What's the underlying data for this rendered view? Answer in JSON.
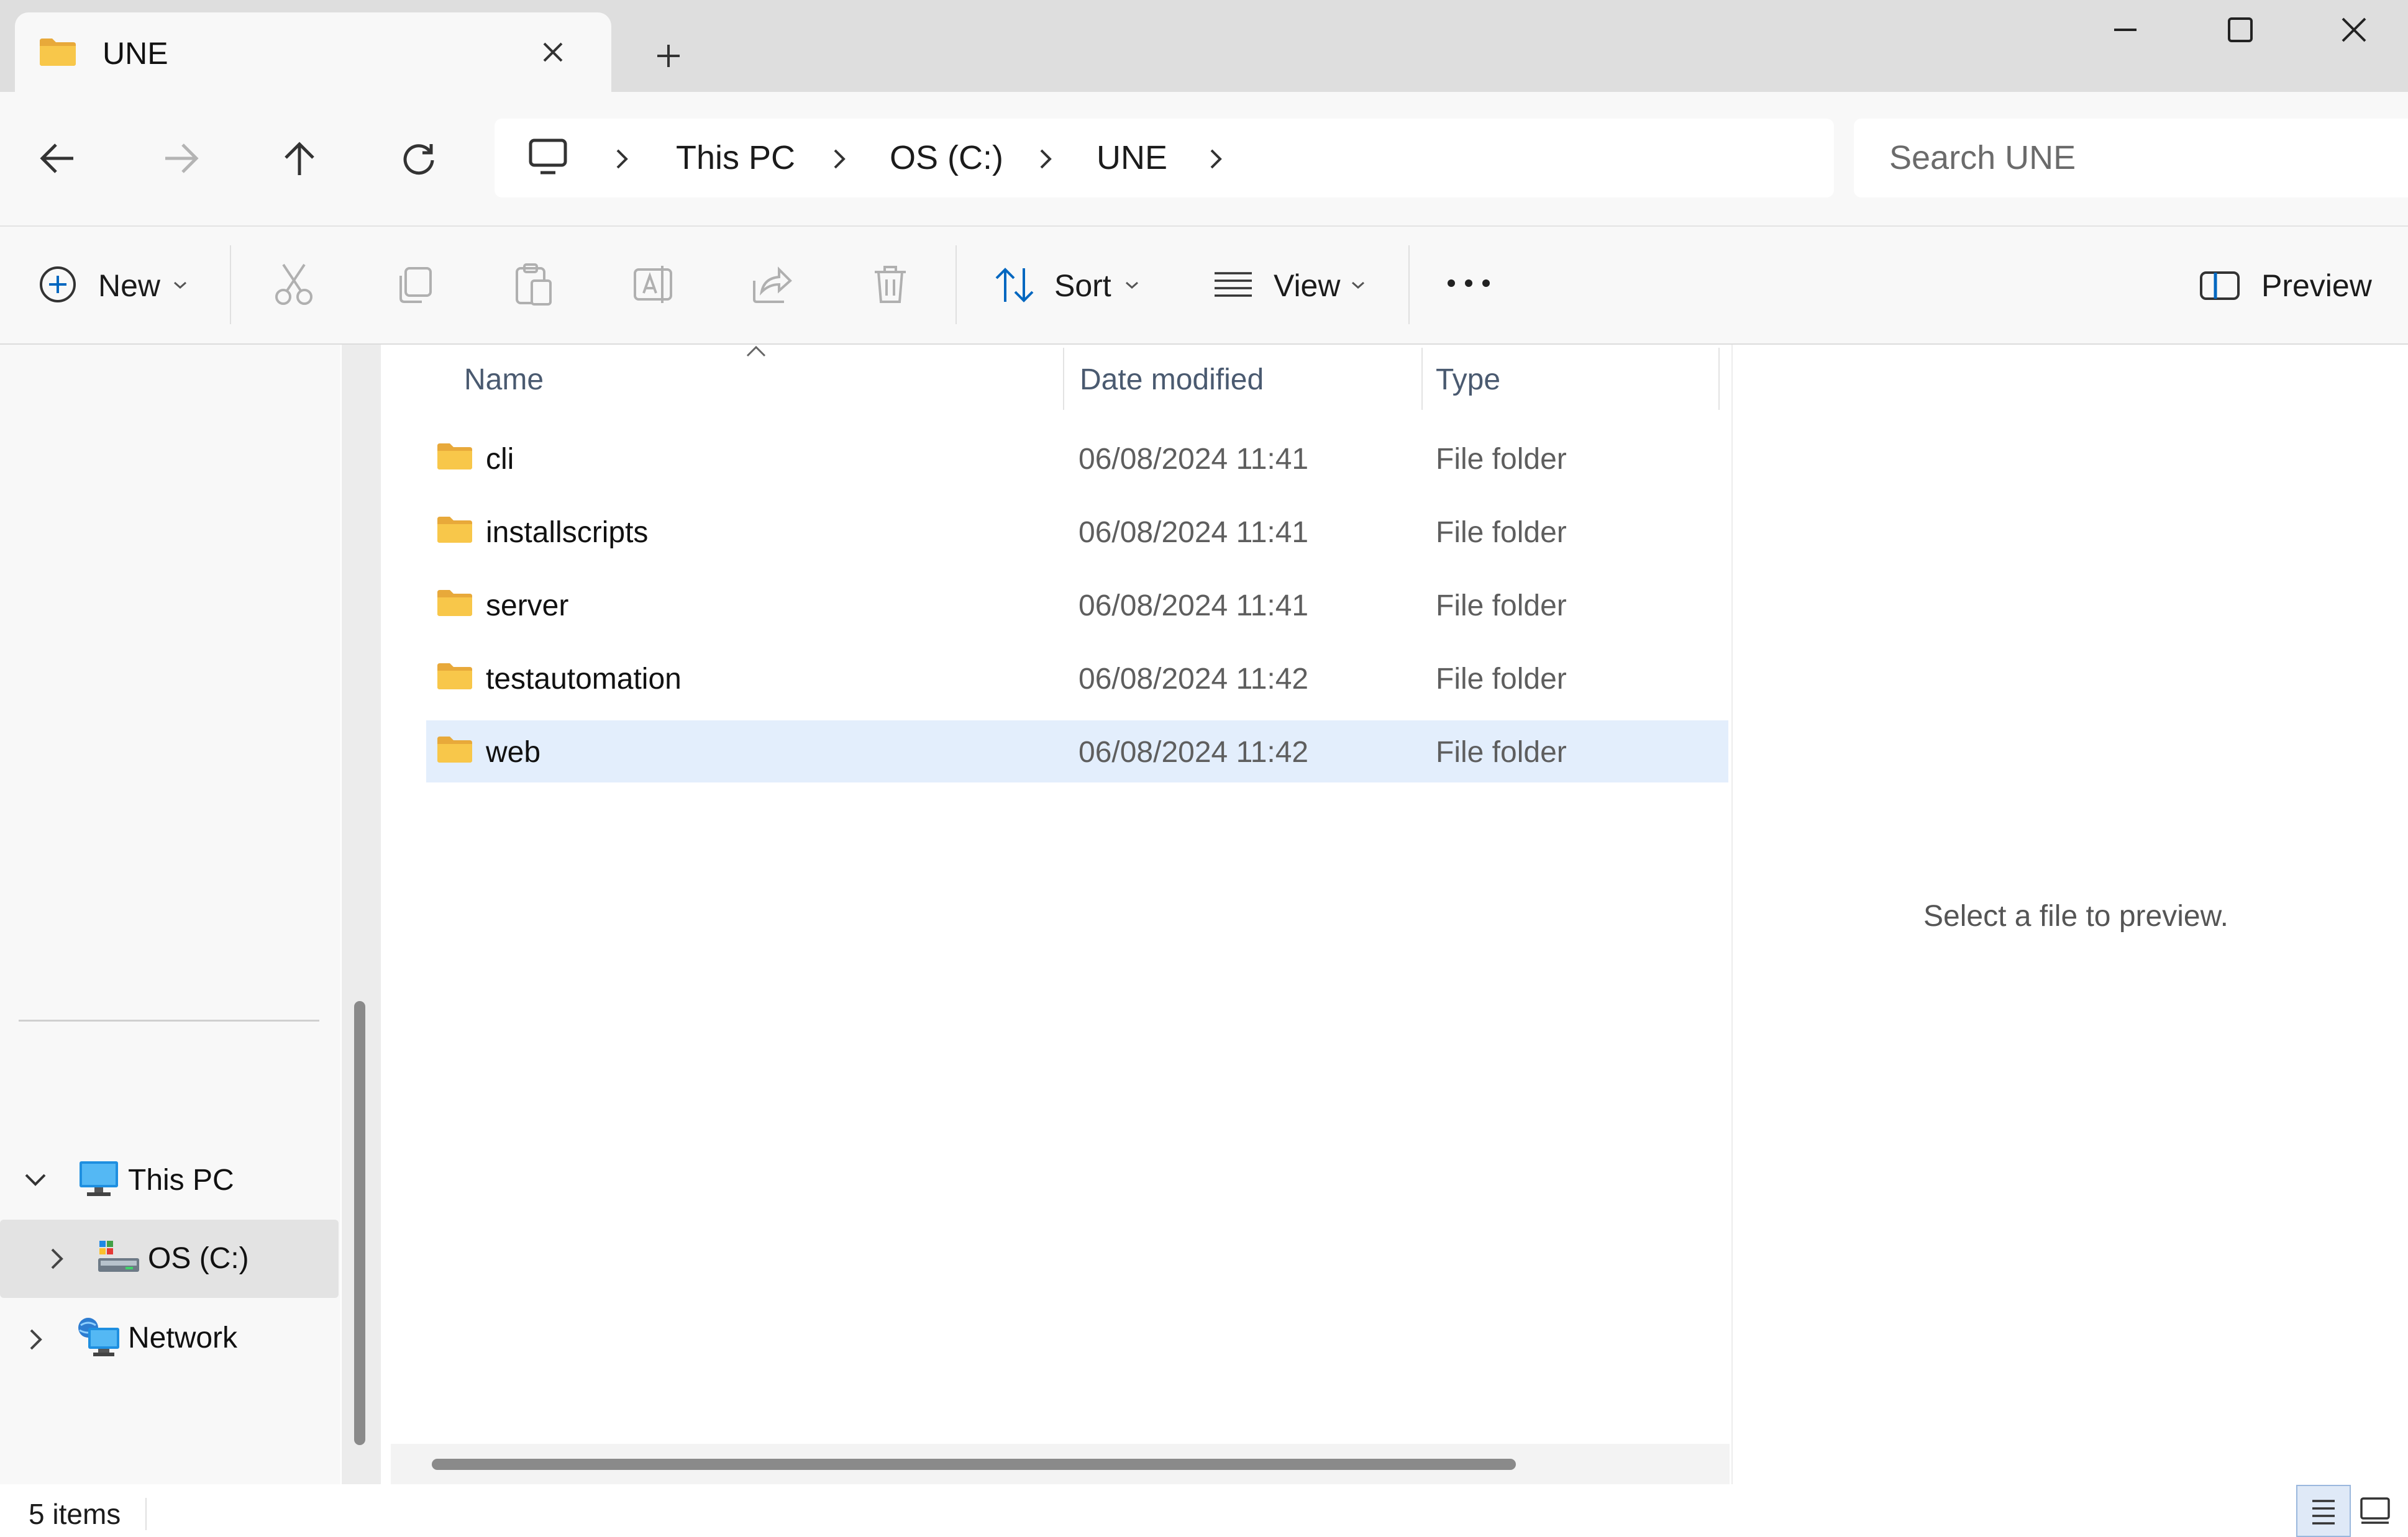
{
  "window": {
    "tab_title": "UNE",
    "icons": {
      "tab_folder": "folder-icon",
      "tab_close": "close-icon",
      "new_tab": "plus-icon",
      "minimize": "minimize-icon",
      "maximize": "maximize-icon",
      "close": "close-icon"
    }
  },
  "navigation": {
    "icons": [
      "back-arrow-icon",
      "forward-arrow-icon",
      "up-arrow-icon",
      "refresh-icon"
    ],
    "breadcrumb": [
      "This PC",
      "OS (C:)",
      "UNE"
    ],
    "search_placeholder": "Search UNE"
  },
  "command_bar": {
    "new_label": "New",
    "sort_label": "Sort",
    "view_label": "View",
    "preview_label": "Preview",
    "disabled_icons": [
      "cut-icon",
      "copy-icon",
      "paste-icon",
      "rename-icon",
      "share-icon",
      "delete-icon"
    ],
    "more_icon": "more-options-icon"
  },
  "nav_pane": {
    "items": [
      {
        "label": "This PC",
        "icon": "computer-icon",
        "expanded": true
      },
      {
        "label": "OS (C:)",
        "icon": "drive-icon",
        "expanded": false,
        "selected": true
      },
      {
        "label": "Network",
        "icon": "network-icon",
        "expanded": false
      }
    ]
  },
  "file_list": {
    "columns": [
      "Name",
      "Date modified",
      "Type"
    ],
    "sort_column": "Name",
    "rows": [
      {
        "name": "cli",
        "date": "06/08/2024 11:41",
        "type": "File folder",
        "selected": false
      },
      {
        "name": "installscripts",
        "date": "06/08/2024 11:41",
        "type": "File folder",
        "selected": false
      },
      {
        "name": "server",
        "date": "06/08/2024 11:41",
        "type": "File folder",
        "selected": false
      },
      {
        "name": "testautomation",
        "date": "06/08/2024 11:42",
        "type": "File folder",
        "selected": false
      },
      {
        "name": "web",
        "date": "06/08/2024 11:42",
        "type": "File folder",
        "selected": true
      }
    ]
  },
  "preview_pane": {
    "message": "Select a file to preview."
  },
  "status_bar": {
    "item_count": "5 items",
    "view_icons": [
      "details-view-icon",
      "large-icons-view-icon"
    ]
  },
  "colors": {
    "accent": "#0067c0",
    "folder": "#f8c74a",
    "selection": "#e3eefc"
  }
}
